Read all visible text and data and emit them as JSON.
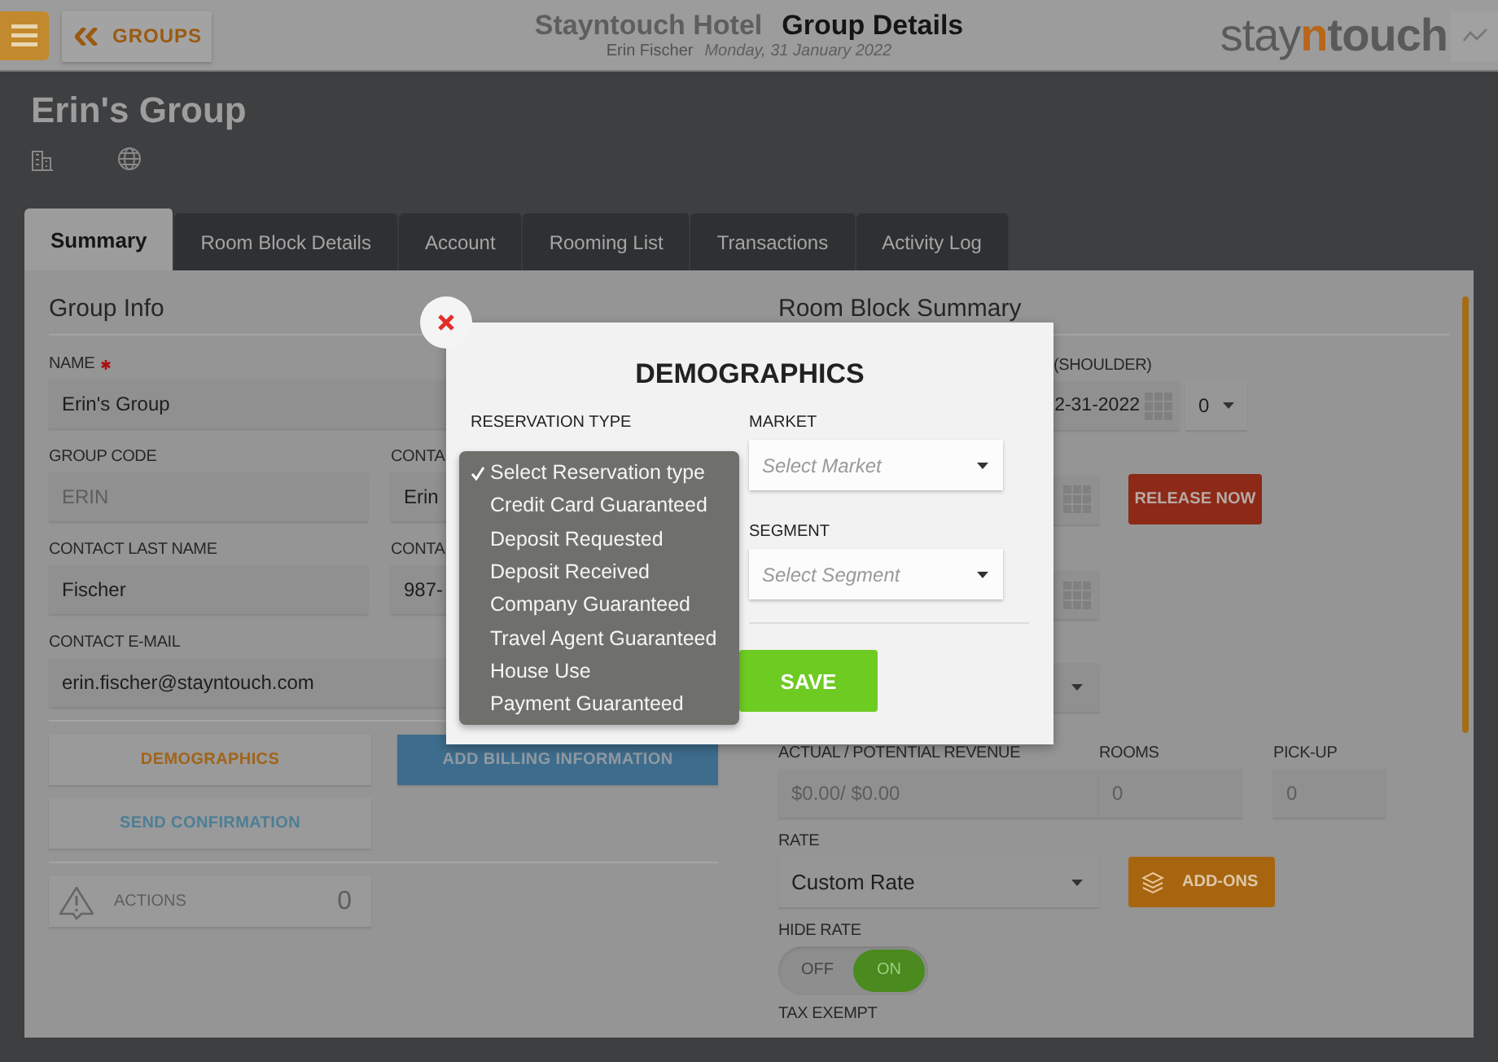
{
  "header": {
    "back_button": "GROUPS",
    "hotel_name": "Stayntouch Hotel",
    "page_title": "Group Details",
    "user": "Erin Fischer",
    "date": "Monday, 31 January 2022",
    "logo": [
      {
        "text": "stay",
        "kind": "light"
      },
      {
        "text": "n",
        "kind": "accent"
      },
      {
        "text": "touch",
        "kind": "bold"
      }
    ]
  },
  "group": {
    "title": "Erin's Group"
  },
  "tabs": [
    {
      "label": "Summary",
      "selected": true
    },
    {
      "label": "Room Block Details",
      "selected": false
    },
    {
      "label": "Account",
      "selected": false
    },
    {
      "label": "Rooming List",
      "selected": false
    },
    {
      "label": "Transactions",
      "selected": false
    },
    {
      "label": "Activity Log",
      "selected": false
    }
  ],
  "group_info": {
    "title": "Group Info",
    "rows": [
      [
        {
          "label": "NAME",
          "required": true,
          "value": "Erin's Group",
          "disabled": false
        }
      ],
      [
        {
          "label": "GROUP CODE",
          "required": false,
          "value": "ERIN",
          "disabled": true
        },
        {
          "label": "CONTA",
          "required": false,
          "value": "Erin",
          "disabled": false
        }
      ],
      [
        {
          "label": "CONTACT LAST NAME",
          "required": false,
          "value": "Fischer",
          "disabled": false
        },
        {
          "label": "CONTA",
          "required": false,
          "value": "987-",
          "disabled": false
        }
      ],
      [
        {
          "label": "CONTACT E-MAIL",
          "required": false,
          "value": "erin.fischer@stayntouch.com",
          "disabled": false
        }
      ]
    ],
    "buttons": [
      {
        "label": "DEMOGRAPHICS",
        "kind": "demographics"
      },
      {
        "label": "ADD BILLING INFORMATION",
        "kind": "billing"
      },
      {
        "label": "SEND CONFIRMATION",
        "kind": "confirmation"
      }
    ],
    "actions": {
      "label": "ACTIONS",
      "count": "0"
    }
  },
  "room_block": {
    "title": "Room Block Summary",
    "shoulder": {
      "label": "(SHOULDER)",
      "date": "2-31-2022",
      "nights": "0"
    },
    "release_button": "RELEASE NOW",
    "stats": [
      {
        "label": "ACTUAL / POTENTIAL REVENUE",
        "value": "$0.00/ $0.00"
      },
      {
        "label": "ROOMS",
        "value": "0"
      },
      {
        "label": "PICK-UP",
        "value": "0"
      }
    ],
    "rate": {
      "label": "RATE",
      "value": "Custom Rate"
    },
    "addons_button": "ADD-ONS",
    "hide_rate": {
      "label": "HIDE RATE",
      "off_label": "OFF",
      "on_label": "ON",
      "on": true
    },
    "tax_exempt": {
      "label": "TAX EXEMPT"
    }
  },
  "modal": {
    "title": "DEMOGRAPHICS",
    "reservation_type": {
      "label": "RESERVATION TYPE",
      "options": [
        {
          "label": "Select Reservation type",
          "selected": true
        },
        {
          "label": "Credit Card Guaranteed",
          "selected": false
        },
        {
          "label": "Deposit Requested",
          "selected": false
        },
        {
          "label": "Deposit Received",
          "selected": false
        },
        {
          "label": "Company Guaranteed",
          "selected": false
        },
        {
          "label": "Travel Agent Guaranteed",
          "selected": false
        },
        {
          "label": "House Use",
          "selected": false
        },
        {
          "label": "Payment Guaranteed",
          "selected": false
        }
      ]
    },
    "market": {
      "label": "MARKET",
      "placeholder": "Select Market"
    },
    "segment": {
      "label": "SEGMENT",
      "placeholder": "Select Segment"
    },
    "save_button": "SAVE"
  }
}
